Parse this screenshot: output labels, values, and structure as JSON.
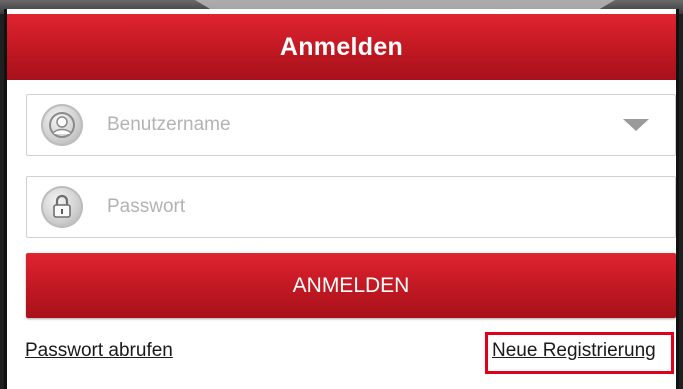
{
  "header": {
    "title": "Anmelden"
  },
  "form": {
    "username": {
      "placeholder": "Benutzername",
      "value": ""
    },
    "password": {
      "placeholder": "Passwort",
      "value": ""
    },
    "login_button_label": "ANMELDEN"
  },
  "links": {
    "forgot_password": "Passwort abrufen",
    "new_registration": "Neue Registrierung"
  },
  "colors": {
    "brand_red": "#c01822",
    "highlight_red": "#e0001a"
  },
  "icons": {
    "username": "user-icon",
    "password": "lock-icon",
    "dropdown": "chevron-down-icon"
  }
}
